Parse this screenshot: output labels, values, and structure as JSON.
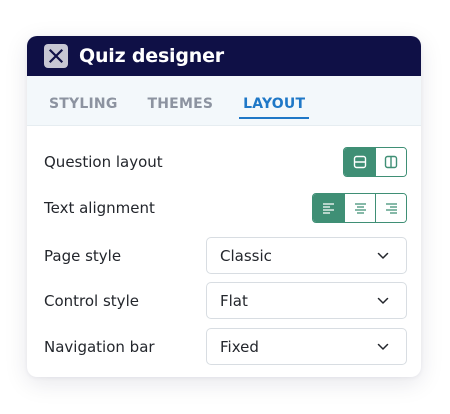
{
  "window": {
    "title": "Quiz designer"
  },
  "tabs": [
    {
      "label": "STYLING",
      "active": false
    },
    {
      "label": "THEMES",
      "active": false
    },
    {
      "label": "LAYOUT",
      "active": true
    }
  ],
  "settings": {
    "question_layout": {
      "label": "Question layout",
      "options": [
        "horizontal-layout-icon",
        "vertical-layout-icon"
      ],
      "selected": 0
    },
    "text_alignment": {
      "label": "Text alignment",
      "options": [
        "align-left-icon",
        "align-center-icon",
        "align-right-icon"
      ],
      "selected": 0
    },
    "page_style": {
      "label": "Page style",
      "value": "Classic"
    },
    "control_style": {
      "label": "Control style",
      "value": "Flat"
    },
    "navigation_bar": {
      "label": "Navigation bar",
      "value": "Fixed"
    }
  },
  "colors": {
    "titlebar": "#0f1046",
    "accent_tab": "#1f78c7",
    "segment_active": "#3f8f75"
  }
}
